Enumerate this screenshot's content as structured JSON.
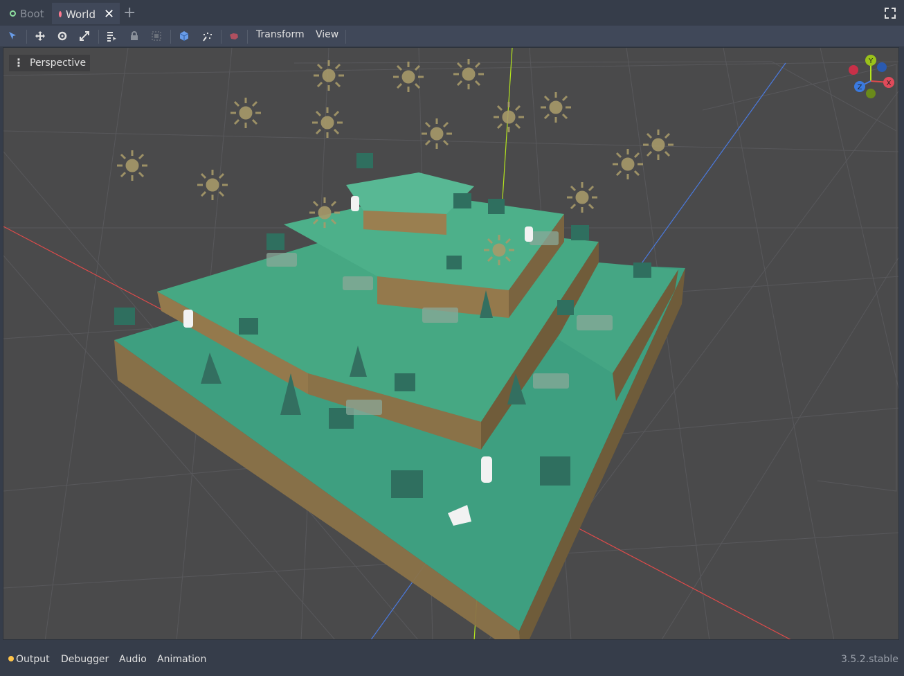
{
  "tabs": [
    {
      "label": "Boot",
      "active": false
    },
    {
      "label": "World",
      "active": true
    }
  ],
  "toolbar": {
    "menus": [
      "Transform",
      "View"
    ]
  },
  "viewport": {
    "mode_label": "Perspective",
    "gizmo": {
      "y": "Y",
      "x": "X",
      "z": "Z"
    }
  },
  "bottom_panel": {
    "items": [
      "Output",
      "Debugger",
      "Audio",
      "Animation"
    ],
    "version": "3.5.2.stable"
  },
  "colors": {
    "accent": "#699ce8",
    "ground": "#3fa886",
    "cliff": "#8a7248",
    "axis_x": "#e04a4a",
    "axis_y": "#b5e61d",
    "axis_z": "#4a7ae0"
  }
}
